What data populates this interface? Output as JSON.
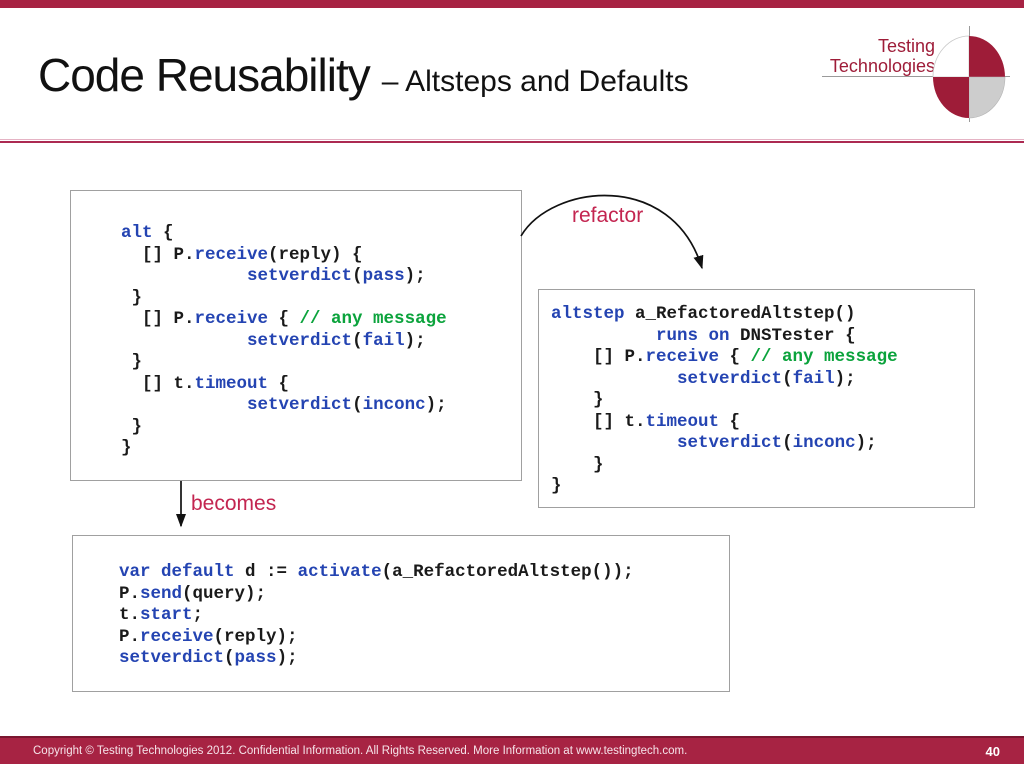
{
  "slide": {
    "title": "Code Reusability",
    "subtitle": "– Altsteps and Defaults",
    "page_number": "40",
    "footer": "Copyright © Testing Technologies 2012. Confidential Information. All Rights Reserved. More Information at www.testingtech.com."
  },
  "logo": {
    "line1": "Testing",
    "line2": "Technologies"
  },
  "labels": {
    "refactor": "refactor",
    "becomes": "becomes"
  },
  "colors": {
    "brand_red": "#a72343",
    "brand_dark_red": "#7a1630",
    "logo_red": "#9e1c38",
    "label_red": "#c32550",
    "keyword_blue": "#2444b2",
    "comment_green": "#0ba33c",
    "code_black": "#1a1a1a"
  },
  "code": {
    "alt_block": {
      "lines": [
        [
          [
            "k",
            "alt"
          ],
          [
            "p",
            " {"
          ]
        ],
        [
          [
            "p",
            "  [] P."
          ],
          [
            "k",
            "receive"
          ],
          [
            "p",
            "(reply) {"
          ]
        ],
        [
          [
            "p",
            "            "
          ],
          [
            "k",
            "setverdict"
          ],
          [
            "p",
            "("
          ],
          [
            "k",
            "pass"
          ],
          [
            "p",
            ");"
          ]
        ],
        [
          [
            "p",
            " }"
          ]
        ],
        [
          [
            "p",
            "  [] P."
          ],
          [
            "k",
            "receive"
          ],
          [
            "p",
            " { "
          ],
          [
            "c",
            "// any message"
          ]
        ],
        [
          [
            "p",
            "            "
          ],
          [
            "k",
            "setverdict"
          ],
          [
            "p",
            "("
          ],
          [
            "k",
            "fail"
          ],
          [
            "p",
            ");"
          ]
        ],
        [
          [
            "p",
            " }"
          ]
        ],
        [
          [
            "p",
            "  [] t."
          ],
          [
            "k",
            "timeout"
          ],
          [
            "p",
            " {"
          ]
        ],
        [
          [
            "p",
            "            "
          ],
          [
            "k",
            "setverdict"
          ],
          [
            "p",
            "("
          ],
          [
            "k",
            "inconc"
          ],
          [
            "p",
            ");"
          ]
        ],
        [
          [
            "p",
            " }"
          ]
        ],
        [
          [
            "p",
            "}"
          ]
        ]
      ]
    },
    "altstep_block": {
      "lines": [
        [
          [
            "k",
            "altstep"
          ],
          [
            "p",
            " a_RefactoredAltstep()"
          ]
        ],
        [
          [
            "p",
            "          "
          ],
          [
            "k",
            "runs on"
          ],
          [
            "p",
            " DNSTester {"
          ]
        ],
        [
          [
            "p",
            "    [] P."
          ],
          [
            "k",
            "receive"
          ],
          [
            "p",
            " { "
          ],
          [
            "c",
            "// any message"
          ]
        ],
        [
          [
            "p",
            "            "
          ],
          [
            "k",
            "setverdict"
          ],
          [
            "p",
            "("
          ],
          [
            "k",
            "fail"
          ],
          [
            "p",
            ");"
          ]
        ],
        [
          [
            "p",
            "    }"
          ]
        ],
        [
          [
            "p",
            "    [] t."
          ],
          [
            "k",
            "timeout"
          ],
          [
            "p",
            " {"
          ]
        ],
        [
          [
            "p",
            "            "
          ],
          [
            "k",
            "setverdict"
          ],
          [
            "p",
            "("
          ],
          [
            "k",
            "inconc"
          ],
          [
            "p",
            ");"
          ]
        ],
        [
          [
            "p",
            "    }"
          ]
        ],
        [
          [
            "p",
            "}"
          ]
        ]
      ]
    },
    "usage_block": {
      "lines": [
        [
          [
            "k",
            "var"
          ],
          [
            "p",
            " "
          ],
          [
            "k",
            "default"
          ],
          [
            "p",
            " d := "
          ],
          [
            "k",
            "activate"
          ],
          [
            "p",
            "(a_RefactoredAltstep());"
          ]
        ],
        [
          [
            "p",
            "P."
          ],
          [
            "k",
            "send"
          ],
          [
            "p",
            "(query);"
          ]
        ],
        [
          [
            "p",
            "t."
          ],
          [
            "k",
            "start"
          ],
          [
            "p",
            ";"
          ]
        ],
        [
          [
            "p",
            "P."
          ],
          [
            "k",
            "receive"
          ],
          [
            "p",
            "(reply);"
          ]
        ],
        [
          [
            "k",
            "setverdict"
          ],
          [
            "p",
            "("
          ],
          [
            "k",
            "pass"
          ],
          [
            "p",
            ");"
          ]
        ]
      ]
    }
  }
}
